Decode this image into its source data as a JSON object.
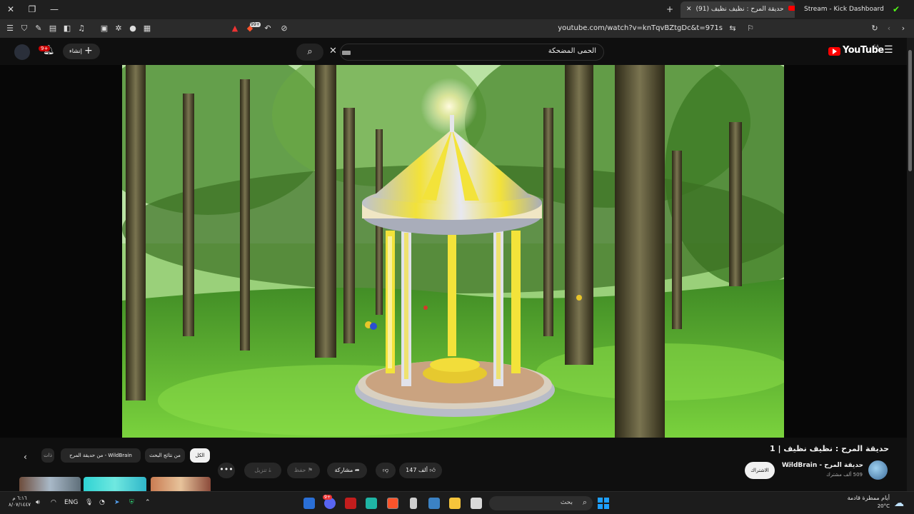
{
  "browser": {
    "tabs": [
      {
        "label": "Stream - Kick Dashboard",
        "active": false
      },
      {
        "label": "(91) حديقة المرح : نظيف نظيف",
        "active": true
      }
    ],
    "url": "youtube.com/watch?v=knTqvBZtgDc&t=971s",
    "adblock_count": "99+"
  },
  "youtube": {
    "logo_text": "YouTube",
    "region": "SA",
    "search_value": "الحمى المضحكة",
    "create_label": "إنشاء",
    "notif_count": "9+"
  },
  "video": {
    "title": "حديقة المرح : نظيف نظيف | 1",
    "channel": "حديقة المرح - WildBrain",
    "subscribers": "509 ألف مشترك",
    "subscribe_label": "الاشتراك",
    "likes": "147 ألف",
    "share_label": "مشاركة",
    "save_label": "حفظ",
    "download_label": "تنزيل"
  },
  "chips": {
    "all": "الكل",
    "search_results": "من نتائج البحث",
    "channel": "من حديقة المرح - WildBrain",
    "more": "ذات"
  },
  "taskbar": {
    "search_placeholder": "بحث",
    "weather_temp": "20°C",
    "weather_text": "أيام ممطرة قادمة",
    "lang": "ENG",
    "time": "٦:١٦ م",
    "date": "٨/٠٧/١٤٤٧",
    "chat_badge": "9+"
  },
  "colors": {
    "yt_red": "#ff0000",
    "bg": "#0f0f0f",
    "chip_bg": "#272727",
    "win_blue": "#1ea0ff"
  }
}
